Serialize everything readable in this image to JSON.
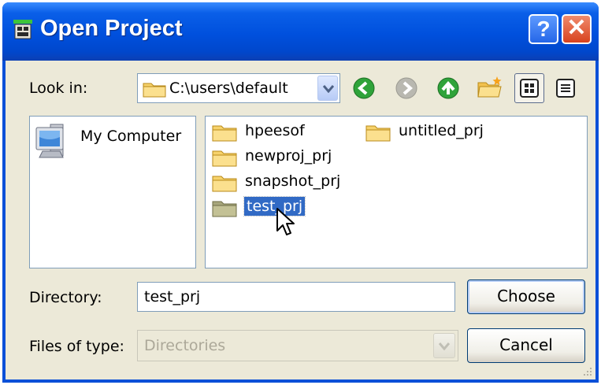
{
  "window": {
    "title": "Open Project",
    "help_symbol": "?",
    "close_symbol": "✕"
  },
  "lookin": {
    "label": "Look in:",
    "value": "C:\\users\\default"
  },
  "toolbar": {
    "icons": [
      "back-icon",
      "forward-icon",
      "up-folder-icon",
      "new-folder-icon",
      "icon-view-icon",
      "list-view-icon"
    ]
  },
  "left_pane": {
    "items": [
      {
        "label": "My Computer",
        "icon": "my-computer-icon"
      }
    ]
  },
  "files": [
    {
      "name": "hpeesof",
      "selected": false
    },
    {
      "name": "newproj_prj",
      "selected": false
    },
    {
      "name": "snapshot_prj",
      "selected": false
    },
    {
      "name": "test_prj",
      "selected": true
    },
    {
      "name": "untitled_prj",
      "selected": false
    }
  ],
  "directory": {
    "label": "Directory:",
    "value": "test_prj"
  },
  "files_of_type": {
    "label": "Files of type:",
    "value": "Directories"
  },
  "buttons": {
    "choose": "Choose",
    "cancel": "Cancel"
  },
  "colors": {
    "title_bar": "#0050dd",
    "selection": "#316ac5",
    "dialog_bg": "#ece9d8"
  }
}
